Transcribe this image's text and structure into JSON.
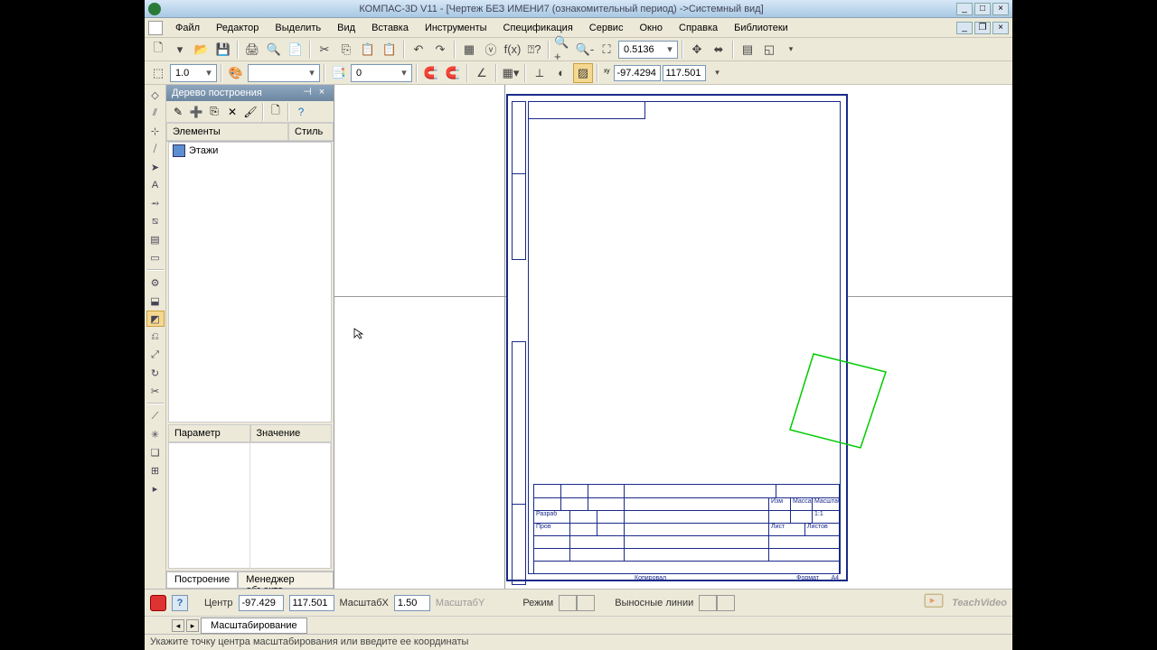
{
  "title": "КОМПАС-3D V11 - [Чертеж БЕЗ ИМЕНИ7 (ознакомительный период) ->Системный вид]",
  "menu": [
    "Файл",
    "Редактор",
    "Выделить",
    "Вид",
    "Вставка",
    "Инструменты",
    "Спецификация",
    "Сервис",
    "Окно",
    "Справка",
    "Библиотеки"
  ],
  "toolbar1": {
    "zoom_value": "0.5136"
  },
  "toolbar2": {
    "scale": "1.0",
    "layer": "0",
    "x": "-97.4294",
    "y": "117.501"
  },
  "panel": {
    "title": "Дерево построения",
    "cols": {
      "a": "Элементы",
      "b": "Стиль"
    },
    "row0": "Этажи",
    "props": {
      "a": "Параметр",
      "b": "Значение"
    },
    "tabs": {
      "a": "Построение",
      "b": "Менеджер объекта ..."
    }
  },
  "titleblock": {
    "t1": "1:1",
    "lab1": "Изм",
    "lab2": "Масса",
    "lab3": "Масштаб",
    "lab4": "Разраб",
    "lab5": "Пров",
    "lab6": "Лист",
    "lab7": "Листов",
    "bot1": "Копировал",
    "bot2": "Формат",
    "bot3": "А4"
  },
  "bottom": {
    "center_lbl": "Центр",
    "cx": "-97.429",
    "cy": "117.501",
    "sx_lbl": "МасштабX",
    "sx": "1.50",
    "sy_lbl": "МасштабY",
    "mode_lbl": "Режим",
    "ext_lbl": "Выносные линии"
  },
  "brand": "TeachVideo",
  "doc_tab": "Масштабирование",
  "status": "Укажите точку центра масштабирования или введите ее координаты"
}
